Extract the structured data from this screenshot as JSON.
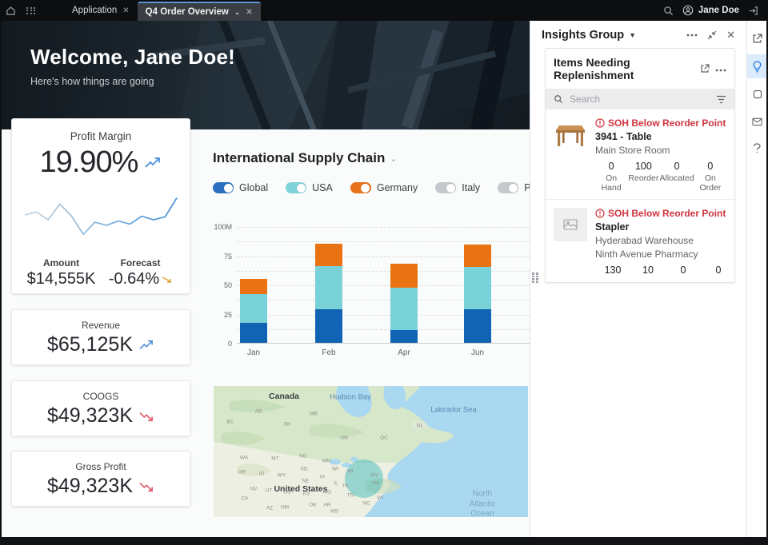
{
  "topbar": {
    "tabs": [
      {
        "label": "Application"
      },
      {
        "label": "Q4 Order Overview"
      }
    ],
    "user": "Jane Doe"
  },
  "hero": {
    "title": "Welcome, Jane Doe!",
    "subtitle": "Here's how things are going"
  },
  "kpis": {
    "profit_margin": {
      "title": "Profit Margin",
      "value": "19.90%",
      "amount_label": "Amount",
      "amount": "$14,555K",
      "forecast_label": "Forecast",
      "forecast": "-0.64%"
    },
    "cards": [
      {
        "title": "Revenue",
        "value": "$65,125K",
        "trend": "up"
      },
      {
        "title": "COOGS",
        "value": "$49,323K",
        "trend": "down"
      },
      {
        "title": "Gross Profit",
        "value": "$49,323K",
        "trend": "down"
      }
    ]
  },
  "supply_chain": {
    "title": "International Supply Chain",
    "toggles": [
      {
        "label": "Global",
        "color": "#2a6fc0",
        "on": true
      },
      {
        "label": "USA",
        "color": "#7fd3d9",
        "on": true
      },
      {
        "label": "Germany",
        "color": "#e8731a",
        "on": true
      },
      {
        "label": "Italy",
        "color": "#c4c9ce",
        "on": false
      },
      {
        "label": "Poland",
        "color": "#c4c9ce",
        "on": false
      }
    ]
  },
  "chart_data": [
    {
      "type": "line",
      "title": "Profit Margin sparkline",
      "values": [
        50,
        55,
        42,
        68,
        48,
        18,
        38,
        33,
        40,
        35,
        48,
        42,
        47,
        78
      ],
      "ylim": [
        0,
        100
      ],
      "color_start": "#c7d3dc",
      "color_end": "#3f8fd8"
    },
    {
      "type": "bar",
      "title": "International Supply Chain",
      "categories": [
        "Jan",
        "Feb",
        "Apr",
        "Jun"
      ],
      "series": [
        {
          "name": "Global",
          "color": "#1164b4",
          "values": [
            17,
            29,
            11,
            29
          ]
        },
        {
          "name": "USA",
          "color": "#79d2d8",
          "values": [
            25,
            37,
            36,
            36
          ]
        },
        {
          "name": "Germany",
          "color": "#e97312",
          "values": [
            13,
            19,
            21,
            19
          ]
        }
      ],
      "stacked": true,
      "ylim": [
        0,
        100
      ],
      "yticks": [
        "0",
        "25",
        "50",
        "75",
        "100M"
      ],
      "grid": "dashed-horizontal",
      "legend_position": "top-toggles"
    },
    {
      "type": "map",
      "region": "North America",
      "highlight": {
        "shape": "circle",
        "color": "#27b0b4",
        "x": 188,
        "y": 116,
        "r": 24
      },
      "labels": [
        {
          "text": "Canada",
          "class": "country",
          "x": 88,
          "y": 13
        },
        {
          "text": "Hudson Bay",
          "class": "water",
          "x": 171,
          "y": 14
        },
        {
          "text": "Labrador Sea",
          "class": "water",
          "x": 300,
          "y": 30
        },
        {
          "text": "United States",
          "class": "country",
          "x": 109,
          "y": 129
        },
        {
          "text": "North\nAtlantic\nOcean",
          "class": "ocean",
          "x": 336,
          "y": 148
        }
      ],
      "states": [
        {
          "t": "BC",
          "x": 21,
          "y": 45
        },
        {
          "t": "AB",
          "x": 56,
          "y": 32
        },
        {
          "t": "SK",
          "x": 92,
          "y": 48
        },
        {
          "t": "MB",
          "x": 125,
          "y": 35
        },
        {
          "t": "ON",
          "x": 163,
          "y": 65
        },
        {
          "t": "QC",
          "x": 213,
          "y": 65
        },
        {
          "t": "NL",
          "x": 258,
          "y": 50
        },
        {
          "t": "WA",
          "x": 38,
          "y": 90
        },
        {
          "t": "MT",
          "x": 77,
          "y": 91
        },
        {
          "t": "ND",
          "x": 112,
          "y": 88
        },
        {
          "t": "MN",
          "x": 141,
          "y": 94
        },
        {
          "t": "OR",
          "x": 35,
          "y": 108
        },
        {
          "t": "ID",
          "x": 60,
          "y": 110
        },
        {
          "t": "WY",
          "x": 85,
          "y": 112
        },
        {
          "t": "SD",
          "x": 113,
          "y": 104
        },
        {
          "t": "WI",
          "x": 152,
          "y": 104
        },
        {
          "t": "MI",
          "x": 171,
          "y": 107
        },
        {
          "t": "NV",
          "x": 50,
          "y": 129
        },
        {
          "t": "UT",
          "x": 69,
          "y": 131
        },
        {
          "t": "CO",
          "x": 92,
          "y": 133
        },
        {
          "t": "NE",
          "x": 115,
          "y": 119
        },
        {
          "t": "IA",
          "x": 136,
          "y": 114
        },
        {
          "t": "IL",
          "x": 153,
          "y": 122
        },
        {
          "t": "IN",
          "x": 165,
          "y": 125
        },
        {
          "t": "CA",
          "x": 39,
          "y": 141
        },
        {
          "t": "AZ",
          "x": 70,
          "y": 153
        },
        {
          "t": "NM",
          "x": 89,
          "y": 152
        },
        {
          "t": "KS",
          "x": 116,
          "y": 135
        },
        {
          "t": "OK",
          "x": 124,
          "y": 149
        },
        {
          "t": "MO",
          "x": 142,
          "y": 133
        },
        {
          "t": "AR",
          "x": 142,
          "y": 149
        },
        {
          "t": "TN",
          "x": 171,
          "y": 137
        },
        {
          "t": "NC",
          "x": 191,
          "y": 147
        },
        {
          "t": "NY",
          "x": 201,
          "y": 112
        },
        {
          "t": "PA",
          "x": 203,
          "y": 122
        },
        {
          "t": "VA",
          "x": 208,
          "y": 140
        },
        {
          "t": "MS",
          "x": 151,
          "y": 157
        }
      ]
    }
  ],
  "insights": {
    "title": "Insights Group",
    "card_title": "Items Needing Replenishment",
    "search_placeholder": "Search",
    "items": [
      {
        "alert": "SOH Below Reorder Point",
        "name": "3941 - Table",
        "location1": "Main Store Room",
        "location2": "",
        "stats": [
          {
            "value": "0",
            "label": "On Hand"
          },
          {
            "value": "100",
            "label": "Reorder"
          },
          {
            "value": "0",
            "label": "Allocated"
          },
          {
            "value": "0",
            "label": "On Order"
          }
        ]
      },
      {
        "alert": "SOH Below Reorder Point",
        "name": "Stapler",
        "location1": "Hyderabad Warehouse",
        "location2": "Ninth Avenue Pharmacy",
        "stats": [
          {
            "value": "130",
            "label": ""
          },
          {
            "value": "10",
            "label": ""
          },
          {
            "value": "0",
            "label": ""
          },
          {
            "value": "0",
            "label": ""
          }
        ]
      }
    ]
  },
  "colors": {
    "alert_red": "#d0343f",
    "trend_up_blue": "#4a90d9",
    "trend_down_red": "#e05563",
    "forecast_amber": "#e2a23b",
    "active_rail_blue": "#1a73e8",
    "tab_accent": "#5b93d6"
  }
}
